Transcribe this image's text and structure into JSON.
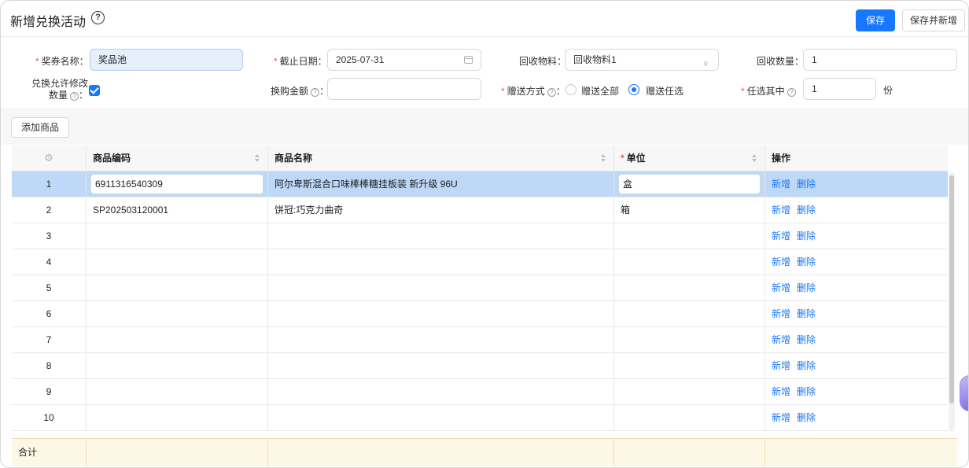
{
  "header": {
    "title": "新增兑换活动",
    "help_glyph": "?",
    "save_label": "保存",
    "save_new_label": "保存并新增"
  },
  "form": {
    "prize_name": {
      "label": "奖券名称：",
      "value": "奖品池",
      "required": true
    },
    "deadline": {
      "label": "截止日期：",
      "value": "2025-07-31",
      "required": true
    },
    "recycle_material": {
      "label": "回收物料：",
      "value": "回收物料1"
    },
    "recycle_qty": {
      "label": "回收数量：",
      "value": "1"
    },
    "allow_modify": {
      "label_line1": "兑换允许修改",
      "label_line2": "数量",
      "colon": "：",
      "checked": true
    },
    "purchase_amount": {
      "label": "换购金额",
      "colon": "：",
      "value": ""
    },
    "gift_method": {
      "label": "赠送方式",
      "colon": "：",
      "required": true,
      "options": [
        "赠送全部",
        "赠送任选"
      ],
      "selected": "赠送任选"
    },
    "choose_any": {
      "label": "任选其中",
      "colon": "",
      "required": true,
      "value": "1",
      "unit": "份"
    },
    "qmark": "?"
  },
  "toolbar": {
    "add_product_label": "添加商品"
  },
  "table": {
    "settings_icon": "⚙",
    "headers": {
      "code": "商品编码",
      "name": "商品名称",
      "unit": "单位",
      "action": "操作"
    },
    "action_add": "新增",
    "action_delete": "删除",
    "rows": [
      {
        "no": "1",
        "code": "6911316540309",
        "name": "阿尔卑斯混合口味棒棒糖挂板装 新升级 96U",
        "unit": "盒"
      },
      {
        "no": "2",
        "code": "SP202503120001",
        "name": "饼冠:巧克力曲奇",
        "unit": "箱"
      },
      {
        "no": "3",
        "code": "",
        "name": "",
        "unit": ""
      },
      {
        "no": "4",
        "code": "",
        "name": "",
        "unit": ""
      },
      {
        "no": "5",
        "code": "",
        "name": "",
        "unit": ""
      },
      {
        "no": "6",
        "code": "",
        "name": "",
        "unit": ""
      },
      {
        "no": "7",
        "code": "",
        "name": "",
        "unit": ""
      },
      {
        "no": "8",
        "code": "",
        "name": "",
        "unit": ""
      },
      {
        "no": "9",
        "code": "",
        "name": "",
        "unit": ""
      },
      {
        "no": "10",
        "code": "",
        "name": "",
        "unit": ""
      }
    ],
    "total_label": "合计"
  },
  "colors": {
    "primary": "#1677ff",
    "required": "#ff4d4f",
    "selected_row": "#bed8f8",
    "total_row": "#fdf7e6"
  }
}
